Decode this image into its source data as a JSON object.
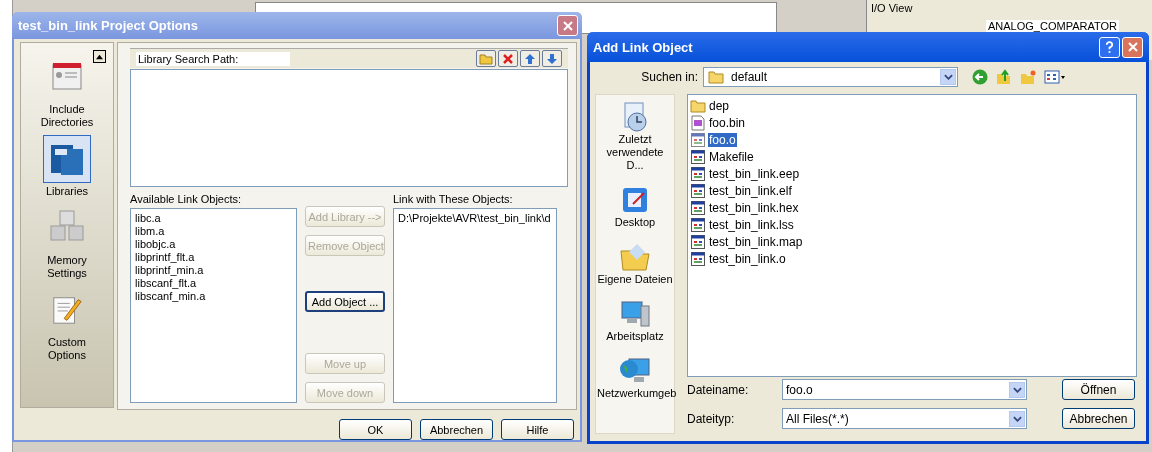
{
  "background": {
    "io_view_title": "I/O View",
    "io_selector": "ANALOG_COMPARATOR"
  },
  "project_options": {
    "title": "test_bin_link Project Options",
    "sidebar": [
      {
        "label": "Include Directories",
        "kind": "include",
        "selected": false
      },
      {
        "label": "Libraries",
        "kind": "libraries",
        "selected": true
      },
      {
        "label": "Memory Settings",
        "kind": "memory",
        "selected": false
      },
      {
        "label": "Custom Options",
        "kind": "custom",
        "selected": false
      }
    ],
    "search_path": {
      "label": "Library Search Path:"
    },
    "available": {
      "label": "Available Link Objects:",
      "items": [
        "libc.a",
        "libm.a",
        "libobjc.a",
        "libprintf_flt.a",
        "libprintf_min.a",
        "libscanf_flt.a",
        "libscanf_min.a"
      ]
    },
    "link_with": {
      "label": "Link with These Objects:",
      "items": [
        "D:\\Projekte\\AVR\\test_bin_link\\d"
      ]
    },
    "middle_buttons": [
      {
        "label": "Add Library -->",
        "disabled": true,
        "focused": false
      },
      {
        "label": "Remove Object",
        "disabled": true,
        "focused": false
      },
      {
        "label": "Add Object ...",
        "disabled": false,
        "focused": true
      },
      {
        "label": "Move up",
        "disabled": true,
        "focused": false
      },
      {
        "label": "Move down",
        "disabled": true,
        "focused": false
      }
    ],
    "footer_buttons": [
      "OK",
      "Abbrechen",
      "Hilfe"
    ]
  },
  "add_link": {
    "title": "Add Link Object",
    "look_in": {
      "label": "Suchen in:",
      "value": "default"
    },
    "places": [
      {
        "label": "Zuletzt verwendete D...",
        "kind": "recent"
      },
      {
        "label": "Desktop",
        "kind": "desktop"
      },
      {
        "label": "Eigene Dateien",
        "kind": "documents"
      },
      {
        "label": "Arbeitsplatz",
        "kind": "computer"
      },
      {
        "label": "Netzwerkumgeb",
        "kind": "network"
      }
    ],
    "files": [
      {
        "name": "dep",
        "kind": "folder",
        "selected": false
      },
      {
        "name": "foo.bin",
        "kind": "hex",
        "selected": false
      },
      {
        "name": "foo.o",
        "kind": "file",
        "selected": true
      },
      {
        "name": "Makefile",
        "kind": "file",
        "selected": false
      },
      {
        "name": "test_bin_link.eep",
        "kind": "file",
        "selected": false
      },
      {
        "name": "test_bin_link.elf",
        "kind": "file",
        "selected": false
      },
      {
        "name": "test_bin_link.hex",
        "kind": "file",
        "selected": false
      },
      {
        "name": "test_bin_link.lss",
        "kind": "file",
        "selected": false
      },
      {
        "name": "test_bin_link.map",
        "kind": "file",
        "selected": false
      },
      {
        "name": "test_bin_link.o",
        "kind": "file",
        "selected": false
      }
    ],
    "filename": {
      "label": "Dateiname:",
      "value": "foo.o"
    },
    "filetype": {
      "label": "Dateityp:",
      "value": "All Files(*.*)"
    },
    "buttons": [
      "Öffnen",
      "Abbrechen"
    ]
  }
}
